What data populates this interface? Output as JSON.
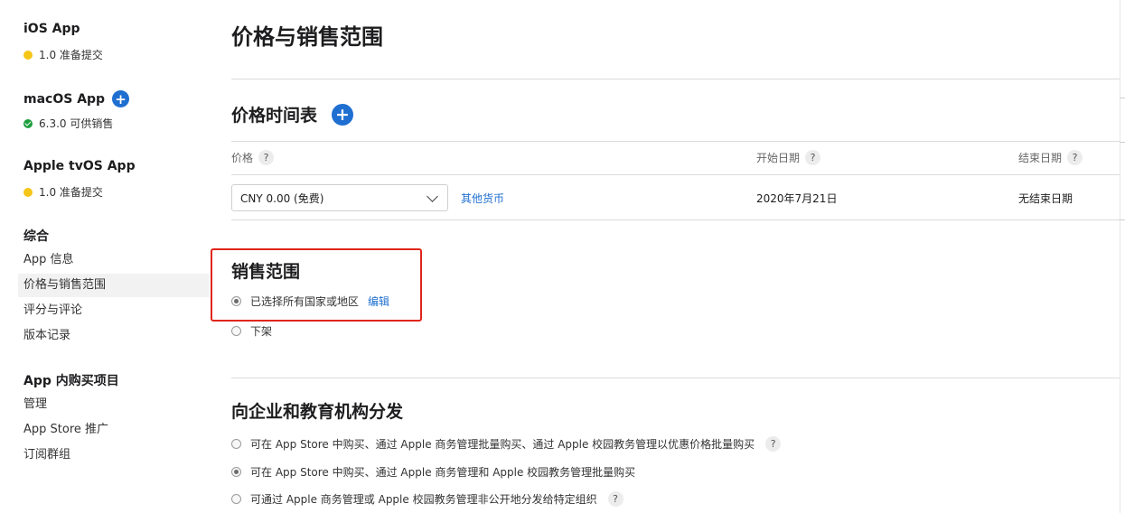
{
  "sidebar": {
    "ios": {
      "title": "iOS App",
      "status": "1.0 准备提交",
      "status_color": "#f5c518"
    },
    "macos": {
      "title": "macOS App",
      "add_icon": "plus-circle-icon",
      "status": "6.3.0 可供销售",
      "status_color": "#1e9e3e"
    },
    "tvos": {
      "title": "Apple tvOS App",
      "status": "1.0 准备提交",
      "status_color": "#f5c518"
    },
    "general": {
      "title": "综合",
      "items": [
        {
          "label": "App 信息",
          "active": false
        },
        {
          "label": "价格与销售范围",
          "active": true
        },
        {
          "label": "评分与评论",
          "active": false
        },
        {
          "label": "版本记录",
          "active": false
        }
      ]
    },
    "iap": {
      "title": "App 内购买项目",
      "items": [
        {
          "label": "管理"
        },
        {
          "label": "App Store 推广"
        },
        {
          "label": "订阅群组"
        }
      ]
    }
  },
  "main": {
    "title": "价格与销售范围",
    "price_schedule": {
      "title": "价格时间表",
      "add_icon": "plus-circle-icon",
      "columns": {
        "price": "价格",
        "start_date": "开始日期",
        "end_date": "结束日期"
      },
      "help_glyph": "?",
      "row": {
        "price_value": "CNY 0.00 (免费)",
        "other_currency": "其他货币",
        "start_date": "2020年7月21日",
        "end_date": "无结束日期"
      }
    },
    "availability": {
      "title": "销售范围",
      "options": [
        {
          "label": "已选择所有国家或地区",
          "checked": true
        },
        {
          "label": "下架",
          "checked": false
        }
      ],
      "edit_link": "编辑"
    },
    "distribution": {
      "title": "向企业和教育机构分发",
      "options": [
        {
          "label": "可在 App Store 中购买、通过 Apple 商务管理批量购买、通过 Apple 校园教务管理以优惠价格批量购买",
          "checked": false,
          "help": true
        },
        {
          "label": "可在 App Store 中购买、通过 Apple 商务管理和 Apple 校园教务管理批量购买",
          "checked": true,
          "help": false
        },
        {
          "label": "可通过 Apple 商务管理或 Apple 校园教务管理非公开地分发给特定组织",
          "checked": false,
          "help": true
        }
      ]
    }
  },
  "colors": {
    "accent": "#1f6fd1",
    "highlight": "#e0261b"
  }
}
